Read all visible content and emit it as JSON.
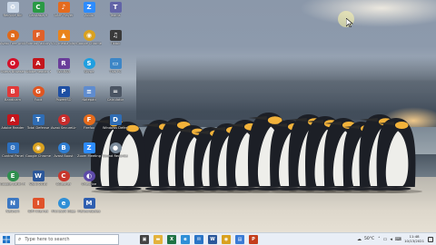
{
  "desktop": {
    "icons": [
      {
        "label": "Recycle Bin",
        "icon": "recycle-bin-icon",
        "color": "#c9d6e6",
        "glyph": "♻",
        "round": false
      },
      {
        "label": "Avast Free Antivirus",
        "icon": "avast-icon",
        "color": "#e06a1b",
        "glyph": "a",
        "round": true
      },
      {
        "label": "Opera Browser",
        "icon": "opera-icon",
        "color": "#d4112a",
        "glyph": "O",
        "round": true
      },
      {
        "label": "Bandicam",
        "icon": "bandicam-icon",
        "color": "#e13a3a",
        "glyph": "B",
        "round": false
      },
      {
        "label": "Adobe Reader",
        "icon": "pdf-reader-icon",
        "color": "#c4151c",
        "glyph": "A",
        "round": false
      },
      {
        "label": "Control Panel",
        "icon": "control-panel-icon",
        "color": "#2c6fbe",
        "glyph": "⚙",
        "round": false
      },
      {
        "label": "Google Earth Pro",
        "icon": "google-earth-icon",
        "color": "#2f8f4e",
        "glyph": "E",
        "round": true
      },
      {
        "label": "Network",
        "icon": "network-icon",
        "color": "#3d78c2",
        "glyph": "N",
        "round": false
      },
      {
        "label": "Camtasia 9",
        "icon": "camtasia-icon",
        "color": "#2a9a45",
        "glyph": "C",
        "round": false
      },
      {
        "label": "Format Factory",
        "icon": "format-factory-icon",
        "color": "#e0612a",
        "glyph": "F",
        "round": false
      },
      {
        "label": "Adobe Reader XI",
        "icon": "adobe-icon",
        "color": "#c4151c",
        "glyph": "A",
        "round": false
      },
      {
        "label": "Foxit",
        "icon": "foxit-icon",
        "color": "#e05520",
        "glyph": "G",
        "round": true
      },
      {
        "label": "Total Defense",
        "icon": "defense-icon",
        "color": "#2f6db5",
        "glyph": "T",
        "round": false
      },
      {
        "label": "Google Chrome",
        "icon": "chrome-icon",
        "color": "#d9a11f",
        "glyph": "◉",
        "round": true
      },
      {
        "label": "Word 2013",
        "icon": "word-icon",
        "color": "#2b579a",
        "glyph": "W",
        "round": false
      },
      {
        "label": "IDM Internet",
        "icon": "idm-icon",
        "color": "#e0522a",
        "glyph": "I",
        "round": false
      },
      {
        "label": "AIMP Player",
        "icon": "aimp-icon",
        "color": "#e46b1f",
        "glyph": "♪",
        "round": false
      },
      {
        "label": "VLC media player",
        "icon": "vlc-icon",
        "color": "#e9841c",
        "glyph": "▲",
        "round": false
      },
      {
        "label": "WinRAR",
        "icon": "winrar-icon",
        "color": "#6a3d9a",
        "glyph": "R",
        "round": false
      },
      {
        "label": "PowerISO",
        "icon": "poweriso-icon",
        "color": "#1e4fa3",
        "glyph": "P",
        "round": false
      },
      {
        "label": "Avast SecureLine",
        "icon": "secureline-icon",
        "color": "#c82c2c",
        "glyph": "S",
        "round": true
      },
      {
        "label": "Avast Boost",
        "icon": "boost-icon",
        "color": "#2f7ed2",
        "glyph": "B",
        "round": true
      },
      {
        "label": "CCleaner",
        "icon": "ccleaner-icon",
        "color": "#c8362c",
        "glyph": "C",
        "round": true
      },
      {
        "label": "Microsoft Edge",
        "icon": "edge-icon",
        "color": "#2f8fd6",
        "glyph": "e",
        "round": true
      },
      {
        "label": "Zoom",
        "icon": "zoom-icon",
        "color": "#2d8cff",
        "glyph": "Z",
        "round": false
      },
      {
        "label": "Google Chrome",
        "icon": "chrome-icon-2",
        "color": "#d9a11f",
        "glyph": "◉",
        "round": true
      },
      {
        "label": "Skype",
        "icon": "skype-icon",
        "color": "#1f9fe0",
        "glyph": "S",
        "round": true
      },
      {
        "label": "Notepad",
        "icon": "notepad-icon",
        "color": "#5f8ccf",
        "glyph": "≡",
        "round": false
      },
      {
        "label": "Firefox",
        "icon": "firefox-icon",
        "color": "#e66b1c",
        "glyph": "F",
        "round": true
      },
      {
        "label": "Zoom Meeting",
        "icon": "zoom-meeting-icon",
        "color": "#2d8cff",
        "glyph": "Z",
        "round": false
      },
      {
        "label": "Onedrive",
        "icon": "onedrive-icon",
        "color": "#5d4aa8",
        "glyph": "◐",
        "round": true
      },
      {
        "label": "Malwarebytes",
        "icon": "malwarebytes-icon",
        "color": "#2f5fb0",
        "glyph": "M",
        "round": false
      },
      {
        "label": "Teams",
        "icon": "teams-icon",
        "color": "#6264a7",
        "glyph": "T",
        "round": false
      },
      {
        "label": "Tiktok",
        "icon": "tiktok-icon",
        "color": "#3a3a3a",
        "glyph": "♫",
        "round": false
      },
      {
        "label": "This PC",
        "icon": "this-pc-icon",
        "color": "#3d86c6",
        "glyph": "▭",
        "round": false
      },
      {
        "label": "Calculator",
        "icon": "calculator-icon",
        "color": "#4b5563",
        "glyph": "=",
        "round": false
      },
      {
        "label": "Windows Defender",
        "icon": "defender-icon",
        "color": "#2f6db5",
        "glyph": "D",
        "round": false
      },
      {
        "label": "Sound Recorder",
        "icon": "recorder-icon",
        "color": "#7a8a9a",
        "glyph": "●",
        "round": true
      }
    ]
  },
  "taskbar": {
    "search_placeholder": "Type here to search",
    "temperature": "50°C",
    "time": "11:48",
    "date": "10/13/2021",
    "apps": [
      {
        "icon": "task-view-icon",
        "color": "#444",
        "glyph": "▣"
      },
      {
        "icon": "file-explorer-icon",
        "color": "#e3b23c",
        "glyph": "▬"
      },
      {
        "icon": "excel-icon",
        "color": "#1f7244",
        "glyph": "X"
      },
      {
        "icon": "edge-taskbar-icon",
        "color": "#2f8fd6",
        "glyph": "e"
      },
      {
        "icon": "mail-icon",
        "color": "#2a74c6",
        "glyph": "✉"
      },
      {
        "icon": "word-taskbar-icon",
        "color": "#2b579a",
        "glyph": "W"
      },
      {
        "icon": "chrome-taskbar-icon",
        "color": "#d9a11f",
        "glyph": "◉"
      },
      {
        "icon": "store-icon",
        "color": "#3a7bd5",
        "glyph": "▤"
      },
      {
        "icon": "powerpoint-icon",
        "color": "#c43e1c",
        "glyph": "P"
      }
    ]
  }
}
